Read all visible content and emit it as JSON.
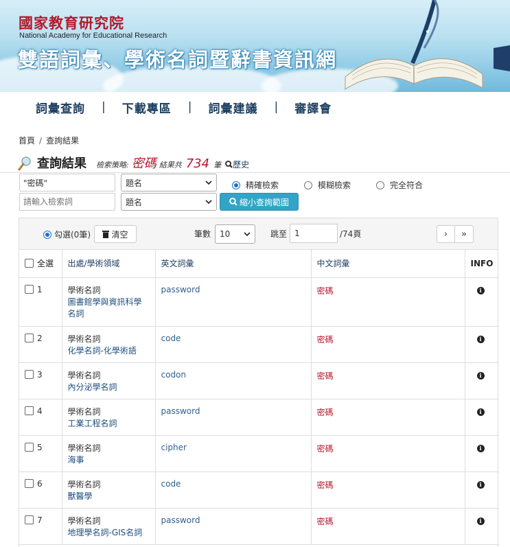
{
  "header": {
    "logo_cn": "國家教育研究院",
    "logo_en": "National Academy for Educational Research",
    "site_title": "雙語詞彙、學術名詞暨辭書資訊網"
  },
  "nav": [
    "詞彙查詢",
    "下載專區",
    "詞彙建議",
    "審譯會"
  ],
  "breadcrumb": {
    "home": "首頁",
    "current": "查詢結果"
  },
  "results": {
    "title": "查詢結果",
    "strategy_label": "檢索策略:",
    "keyword": "密碼",
    "total_label": "結果共",
    "total": "734",
    "unit": "筆",
    "history": "歷史"
  },
  "search": {
    "input1_value": "\"密碼\"",
    "input2_placeholder": "請輸入檢索詞",
    "field1": "題名",
    "field2": "題名",
    "modes": [
      "精確檢索",
      "模糊檢索",
      "完全符合"
    ],
    "narrow_button": "縮小查詢範圍"
  },
  "toolbar": {
    "selected": "勾選(0筆)",
    "clear": "清空",
    "count_label": "筆數",
    "count_value": "10",
    "jump_label": "跳至",
    "page_value": "1",
    "total_pages": "/74頁",
    "next": "›",
    "last": "»"
  },
  "table": {
    "headers": {
      "select_all": "全選",
      "source": "出處/學術領域",
      "english": "英文詞彙",
      "chinese": "中文詞彙",
      "info": "INFO"
    },
    "rows": [
      {
        "no": "1",
        "type": "學術名詞",
        "field": "圖書館學與資訊科學名詞",
        "en": "password",
        "zh": "密碼"
      },
      {
        "no": "2",
        "type": "學術名詞",
        "field": "化學名詞-化學術語",
        "en": "code",
        "zh": "密碼"
      },
      {
        "no": "3",
        "type": "學術名詞",
        "field": "內分泌學名詞",
        "en": "codon",
        "zh": "密碼"
      },
      {
        "no": "4",
        "type": "學術名詞",
        "field": "工業工程名詞",
        "en": "password",
        "zh": "密碼"
      },
      {
        "no": "5",
        "type": "學術名詞",
        "field": "海事",
        "en": "cipher",
        "zh": "密碼"
      },
      {
        "no": "6",
        "type": "學術名詞",
        "field": "獸醫學",
        "en": "code",
        "zh": "密碼"
      },
      {
        "no": "7",
        "type": "學術名詞",
        "field": "地理學名詞-GIS名詞",
        "en": "password",
        "zh": "密碼"
      }
    ]
  }
}
